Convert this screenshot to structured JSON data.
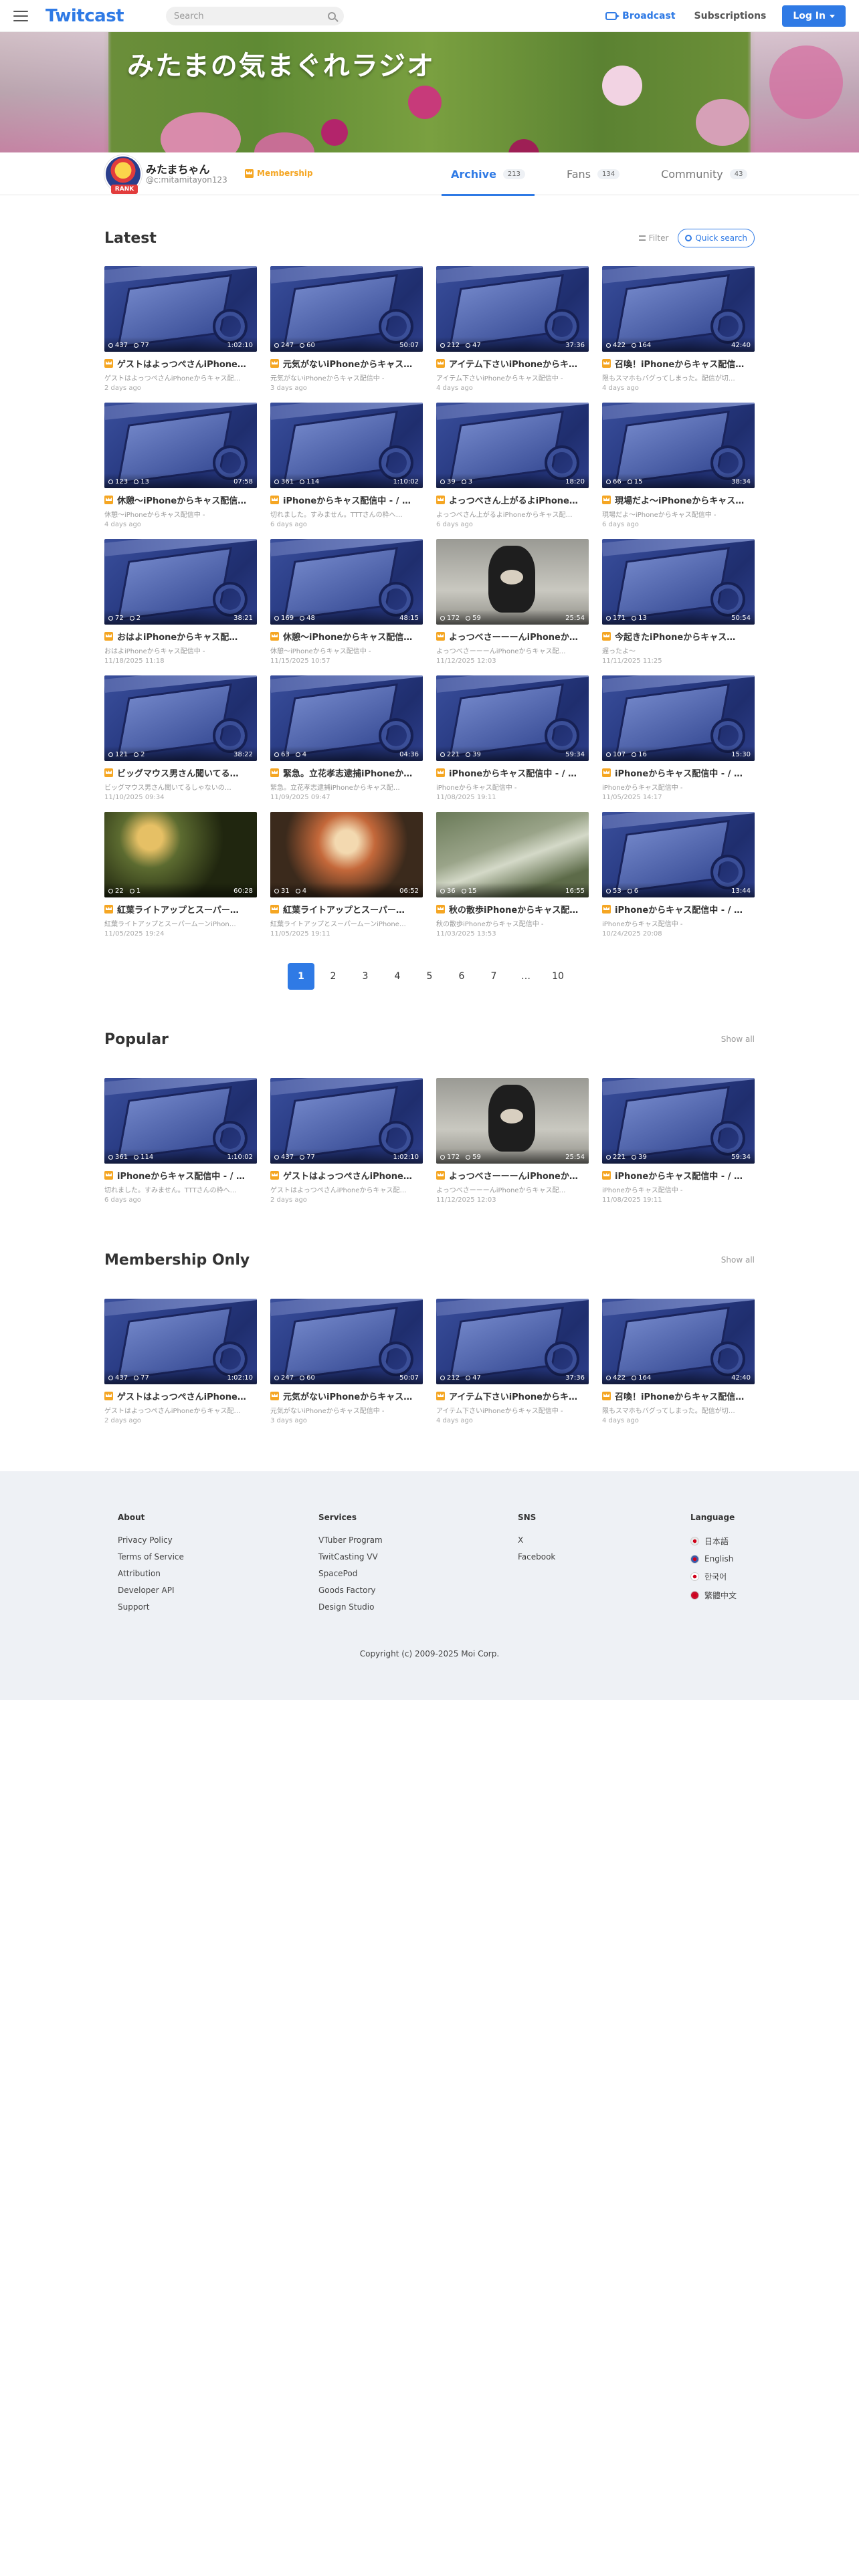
{
  "header": {
    "logo": "Twitcast",
    "search_placeholder": "Search",
    "broadcast": "Broadcast",
    "subscriptions": "Subscriptions",
    "login": "Log In"
  },
  "banner": {
    "title": "みたまの気まぐれラジオ"
  },
  "profile": {
    "name": "みたまちゃん",
    "id": "@c:mitamitayon123",
    "avatar_badge": "RANK",
    "membership": "Membership",
    "tabs": [
      {
        "label": "Archive",
        "count": "213"
      },
      {
        "label": "Fans",
        "count": "134"
      },
      {
        "label": "Community",
        "count": "43"
      }
    ]
  },
  "latest": {
    "title": "Latest",
    "filter": "Filter",
    "quick_search": "Quick search",
    "items": [
      {
        "views": "437",
        "comments": "77",
        "duration": "1:02:10",
        "title": "ゲストはよっつぺさんiPhone…",
        "sub": "ゲストはよっつぺさんiPhoneからキャス配…",
        "date": "2 days ago",
        "thumb": "ipad"
      },
      {
        "views": "247",
        "comments": "60",
        "duration": "50:07",
        "title": "元気がないiPhoneからキャス…",
        "sub": "元気がないiPhoneからキャス配信中 -",
        "date": "3 days ago",
        "thumb": "ipad"
      },
      {
        "views": "212",
        "comments": "47",
        "duration": "37:36",
        "title": "アイテム下さいiPhoneからキ…",
        "sub": "アイテム下さいiPhoneからキャス配信中 -",
        "date": "4 days ago",
        "thumb": "ipad"
      },
      {
        "views": "422",
        "comments": "164",
        "duration": "42:40",
        "title": "召喚！iPhoneからキャス配信…",
        "sub": "限もスマホもバグってしまった。配信が切…",
        "date": "4 days ago",
        "thumb": "ipad"
      },
      {
        "views": "123",
        "comments": "13",
        "duration": "07:58",
        "title": "休憩〜iPhoneからキャス配信…",
        "sub": "休憩〜iPhoneからキャス配信中 -",
        "date": "4 days ago",
        "thumb": "ipad"
      },
      {
        "views": "361",
        "comments": "114",
        "duration": "1:10:02",
        "title": "iPhoneからキャス配信中 - / …",
        "sub": "切れました。すみません。TTTさんの枠へ…",
        "date": "6 days ago",
        "thumb": "ipad"
      },
      {
        "views": "39",
        "comments": "3",
        "duration": "18:20",
        "title": "よっつべさん上がるよiPhone…",
        "sub": "よっつべさん上がるよiPhoneからキャス配…",
        "date": "6 days ago",
        "thumb": "ipad"
      },
      {
        "views": "66",
        "comments": "15",
        "duration": "38:34",
        "title": "現場だよ〜iPhoneからキャス…",
        "sub": "現場だよ〜iPhoneからキャス配信中 -",
        "date": "6 days ago",
        "thumb": "ipad"
      },
      {
        "views": "72",
        "comments": "2",
        "duration": "38:21",
        "title": "おはよiPhoneからキャス配…",
        "sub": "おはよiPhoneからキャス配信中 -",
        "date": "11/18/2025 11:18",
        "thumb": "ipad"
      },
      {
        "views": "169",
        "comments": "48",
        "duration": "48:15",
        "title": "休憩〜iPhoneからキャス配信…",
        "sub": "休憩〜iPhoneからキャス配信中 -",
        "date": "11/15/2025 10:57",
        "thumb": "ipad"
      },
      {
        "views": "172",
        "comments": "59",
        "duration": "25:54",
        "title": "よっつべさーーーんiPhoneか…",
        "sub": "よっつべさーーーんiPhoneからキャス配…",
        "date": "11/12/2025 12:03",
        "thumb": "dog"
      },
      {
        "views": "171",
        "comments": "13",
        "duration": "50:54",
        "title": "今起きたiPhoneからキャス…",
        "sub": "遅ったよ〜",
        "date": "11/11/2025 11:25",
        "thumb": "ipad"
      },
      {
        "views": "121",
        "comments": "2",
        "duration": "38:22",
        "title": "ビッグマウス男さん聞いてる…",
        "sub": "ビッグマウス男さん聞いてるしゃないの…",
        "date": "11/10/2025 09:34",
        "thumb": "ipad"
      },
      {
        "views": "63",
        "comments": "4",
        "duration": "04:36",
        "title": "緊急。立花孝志逮捕iPhoneか…",
        "sub": "緊急。立花孝志逮捕iPhoneからキャス配…",
        "date": "11/09/2025 09:47",
        "thumb": "ipad"
      },
      {
        "views": "221",
        "comments": "39",
        "duration": "59:34",
        "title": "iPhoneからキャス配信中 - / …",
        "sub": "iPhoneからキャス配信中 -",
        "date": "11/08/2025 19:11",
        "thumb": "ipad"
      },
      {
        "views": "107",
        "comments": "16",
        "duration": "15:30",
        "title": "iPhoneからキャス配信中 - / …",
        "sub": "iPhoneからキャス配信中 -",
        "date": "11/05/2025 14:17",
        "thumb": "ipad"
      },
      {
        "views": "22",
        "comments": "1",
        "duration": "60:28",
        "title": "紅葉ライトアップとスーパー…",
        "sub": "紅葉ライトアップとスーパームーンiPhon…",
        "date": "11/05/2025 19:24",
        "thumb": "night"
      },
      {
        "views": "31",
        "comments": "4",
        "duration": "06:52",
        "title": "紅葉ライトアップとスーパー…",
        "sub": "紅葉ライトアップとスーパームーンiPhone…",
        "date": "11/05/2025 19:11",
        "thumb": "fall"
      },
      {
        "views": "36",
        "comments": "15",
        "duration": "16:55",
        "title": "秋の散歩iPhoneからキャス配…",
        "sub": "秋の散歩iPhoneからキャス配信中 -",
        "date": "11/03/2025 13:53",
        "thumb": "path"
      },
      {
        "views": "53",
        "comments": "6",
        "duration": "13:44",
        "title": "iPhoneからキャス配信中 - / …",
        "sub": "iPhoneからキャス配信中 -",
        "date": "10/24/2025 20:08",
        "thumb": "ipad"
      }
    ],
    "pages": [
      "1",
      "2",
      "3",
      "4",
      "5",
      "6",
      "7",
      "…",
      "10"
    ]
  },
  "popular": {
    "title": "Popular",
    "show_all": "Show all",
    "items": [
      {
        "views": "361",
        "comments": "114",
        "duration": "1:10:02",
        "title": "iPhoneからキャス配信中 - / …",
        "sub": "切れました。すみません。TTTさんの枠へ…",
        "date": "6 days ago",
        "thumb": "ipad"
      },
      {
        "views": "437",
        "comments": "77",
        "duration": "1:02:10",
        "title": "ゲストはよっつぺさんiPhone…",
        "sub": "ゲストはよっつぺさんiPhoneからキャス配…",
        "date": "2 days ago",
        "thumb": "ipad"
      },
      {
        "views": "172",
        "comments": "59",
        "duration": "25:54",
        "title": "よっつべさーーーんiPhoneか…",
        "sub": "よっつべさーーーんiPhoneからキャス配…",
        "date": "11/12/2025 12:03",
        "thumb": "dog"
      },
      {
        "views": "221",
        "comments": "39",
        "duration": "59:34",
        "title": "iPhoneからキャス配信中 - / …",
        "sub": "iPhoneからキャス配信中 -",
        "date": "11/08/2025 19:11",
        "thumb": "ipad"
      }
    ]
  },
  "membership_only": {
    "title": "Membership Only",
    "show_all": "Show all",
    "items": [
      {
        "views": "437",
        "comments": "77",
        "duration": "1:02:10",
        "title": "ゲストはよっつぺさんiPhone…",
        "sub": "ゲストはよっつぺさんiPhoneからキャス配…",
        "date": "2 days ago",
        "thumb": "ipad"
      },
      {
        "views": "247",
        "comments": "60",
        "duration": "50:07",
        "title": "元気がないiPhoneからキャス…",
        "sub": "元気がないiPhoneからキャス配信中 -",
        "date": "3 days ago",
        "thumb": "ipad"
      },
      {
        "views": "212",
        "comments": "47",
        "duration": "37:36",
        "title": "アイテム下さいiPhoneからキ…",
        "sub": "アイテム下さいiPhoneからキャス配信中 -",
        "date": "4 days ago",
        "thumb": "ipad"
      },
      {
        "views": "422",
        "comments": "164",
        "duration": "42:40",
        "title": "召喚！iPhoneからキャス配信…",
        "sub": "限もスマホもバグってしまった。配信が切…",
        "date": "4 days ago",
        "thumb": "ipad"
      }
    ]
  },
  "footer": {
    "about": {
      "title": "About",
      "links": [
        "Privacy Policy",
        "Terms of Service",
        "Attribution",
        "Developer API",
        "Support"
      ]
    },
    "services": {
      "title": "Services",
      "links": [
        "VTuber Program",
        "TwitCasting VV",
        "SpacePod",
        "Goods Factory",
        "Design Studio"
      ]
    },
    "sns": {
      "title": "SNS",
      "links": [
        "X",
        "Facebook"
      ]
    },
    "language": {
      "title": "Language",
      "links": [
        "日本語",
        "English",
        "한국어",
        "繁體中文"
      ]
    },
    "copyright": "Copyright (c) 2009-2025 Moi Corp."
  },
  "colors": {
    "accent": "#2f7ae5",
    "membership": "#f5a623"
  }
}
